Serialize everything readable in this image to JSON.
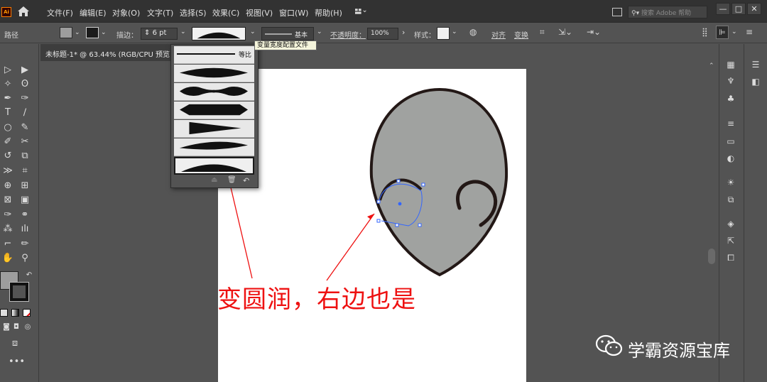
{
  "app": {
    "logo": "Ai",
    "menus": [
      "文件(F)",
      "编辑(E)",
      "对象(O)",
      "文字(T)",
      "选择(S)",
      "效果(C)",
      "视图(V)",
      "窗口(W)",
      "帮助(H)"
    ],
    "search_placeholder": "搜索 Adobe 帮助",
    "window_buttons": [
      "—",
      "□",
      "✕"
    ]
  },
  "control_bar": {
    "object_label": "路径",
    "stroke_label": "描边：",
    "stroke_value": "6 pt",
    "brush_label": "基本",
    "opacity_label": "不透明度：",
    "opacity_value": "100%",
    "style_label": "样式：",
    "align_label": "对齐",
    "transform_label": "变换",
    "fill_color": "#9d9d9d"
  },
  "document": {
    "tab_title": "未标题-1* @ 63.44% (RGB/CPU 预览)"
  },
  "profile_dropdown": {
    "first_item_label": "等比",
    "tooltip": "变量宽度配置文件"
  },
  "canvas": {
    "head_fill": "#a0a2a0",
    "outline_color": "#231816",
    "selection_color": "#3366ff",
    "annotation_text": "变圆润，右边也是",
    "annotation_color": "#ee1111"
  },
  "watermark": {
    "text": "学霸资源宝库"
  },
  "icons": [
    "home-icon",
    "workspace-icon",
    "search-icon",
    "selection-tool-icon",
    "direct-selection-tool-icon",
    "pen-tool-icon",
    "type-tool-icon",
    "hand-tool-icon",
    "zoom-tool-icon",
    "delete-icon",
    "reset-icon",
    "wechat-icon"
  ]
}
